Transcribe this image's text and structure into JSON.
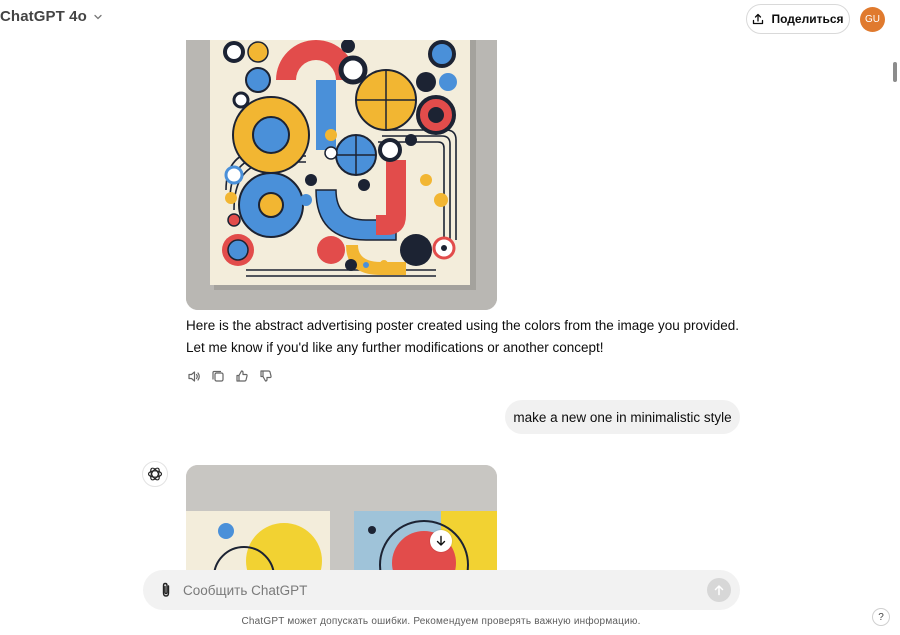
{
  "header": {
    "model_name": "ChatGPT 4o",
    "share_label": "Поделиться",
    "avatar_initials": "GU",
    "avatar_color": "#e07a2e"
  },
  "conversation": {
    "assistant_message_1": {
      "image": "abstract-poster-image",
      "text": "Here is the abstract advertising poster created using the colors from the image you provided. Let me know if you'd like any further modifications or another concept!",
      "actions": [
        "read-aloud-icon",
        "copy-icon",
        "thumbs-up-icon",
        "thumbs-down-icon"
      ]
    },
    "user_message_1": {
      "text": "make a new one in minimalistic style"
    },
    "assistant_message_2": {
      "image": "minimalist-poster-image",
      "icons": [
        "openai-logo-icon",
        "download-icon"
      ]
    }
  },
  "composer": {
    "placeholder": "Сообщить ChatGPT",
    "value": ""
  },
  "footer": {
    "disclaimer": "ChatGPT может допускать ошибки. Рекомендуем проверять важную информацию.",
    "help_label": "?"
  },
  "palette": {
    "blue": "#4a90d9",
    "yellow": "#f2b632",
    "red": "#e24c4b",
    "navy": "#1c2333",
    "cream": "#f3eddb"
  }
}
